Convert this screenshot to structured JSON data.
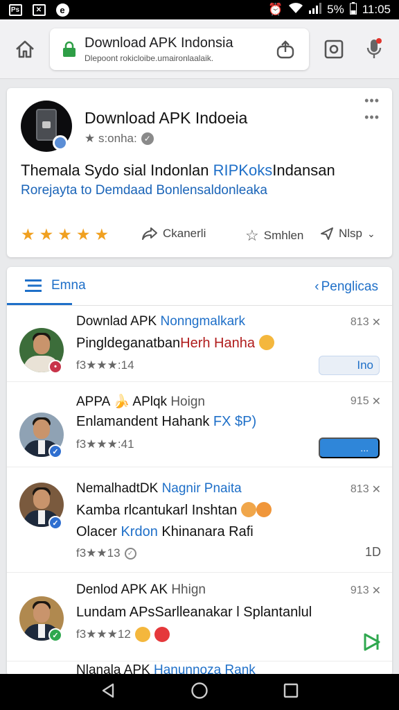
{
  "status_bar": {
    "left_icons": [
      "image-icon",
      "close-box-icon",
      "data-saver-icon"
    ],
    "battery": "5%",
    "time": "11:05"
  },
  "browser": {
    "title": "Download APK Indonsia",
    "subtitle": "Dlepoont rokicloibe.umaironlaalaik."
  },
  "app_card": {
    "title": "Download APK Indoeia",
    "subtitle": "★ s:onha:",
    "desc_line1_a": "Themala Sydo sial Indonlan",
    "desc_line1_b": "RIPKoks",
    "desc_line1_c": "Indansan",
    "desc_line2": "Rorejayta to Demdaad Bonlensaldonleaka",
    "stars": 5,
    "action_share": "Ckanerli",
    "action_save": "Smhlen",
    "action_more": "Nlsp"
  },
  "list": {
    "tab_left": "Emna",
    "tab_right": "Penglicas",
    "rows": [
      {
        "title_a": "Downlad APK",
        "title_b": "Nonngmalkark",
        "line1_a": "Pingldeganatban",
        "line1_b": "Herh Hanha",
        "meta": "f3★★★:14",
        "num": "813",
        "button": "Ino"
      },
      {
        "title_a": "APPA 🍌 APlqk",
        "title_b": "Hoign",
        "line1_a": "Enlamandent Hahank",
        "line1_b": "FX $P)",
        "meta": "f3★★★:41",
        "num": "915",
        "button": "..."
      },
      {
        "title_a": "NemalhadtDK",
        "title_b": "Nagnir Pnaita",
        "line1_a": "Kamba rlcantukarl Inshtan",
        "line2_a": "Olacer",
        "line2_b": "Krdon",
        "line2_c": "Khinanara Rafi",
        "meta": "f3★★13",
        "num": "813",
        "side": "1D"
      },
      {
        "title_a": "Denlod APK AK",
        "title_b": "Hhign",
        "line1_a": "Lundam APsSarlleanakar l Splantanlul",
        "meta": "f3★★★12",
        "num": "913"
      },
      {
        "title_a": "Nlanala APK",
        "title_b": "Hanunnoza Rank"
      }
    ]
  },
  "colors": {
    "accent": "#1e6fc8",
    "star": "#f0a020",
    "button_blue": "#2f86d9",
    "lock_green": "#2e9e46"
  }
}
